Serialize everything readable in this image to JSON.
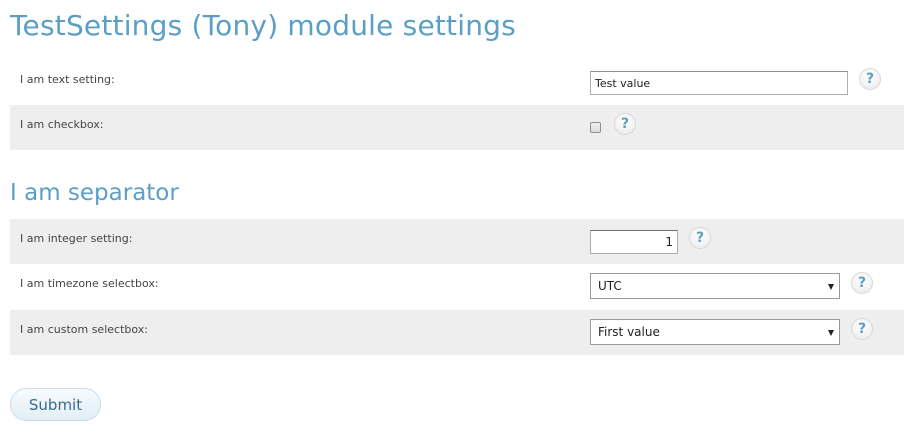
{
  "page": {
    "title": "TestSettings (Tony) module settings"
  },
  "colors": {
    "heading": "#5b9fc7",
    "row_shade": "#eeeeee",
    "help_icon": "#5b9fc7"
  },
  "settings": {
    "text_setting": {
      "label": "I am text setting:",
      "value": "Test value"
    },
    "checkbox": {
      "label": "I am checkbox:",
      "checked": false
    }
  },
  "separator": {
    "title": "I am separator"
  },
  "more_settings": {
    "integer_setting": {
      "label": "I am integer setting:",
      "value": "1"
    },
    "timezone_select": {
      "label": "I am timezone selectbox:",
      "selected": "UTC"
    },
    "custom_select": {
      "label": "I am custom selectbox:",
      "selected": "First value"
    }
  },
  "help": {
    "glyph": "?",
    "icon": "help-icon"
  },
  "form": {
    "submit_label": "Submit"
  }
}
